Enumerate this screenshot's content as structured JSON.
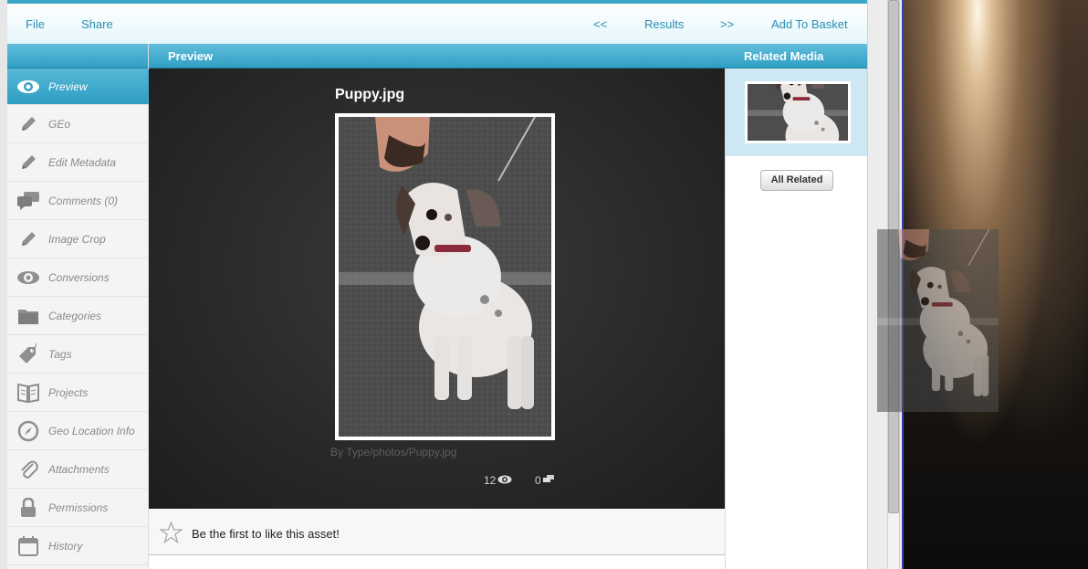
{
  "menu": {
    "file": "File",
    "share": "Share",
    "prev": "<<",
    "results": "Results",
    "next": ">>",
    "add_to_basket": "Add To Basket"
  },
  "headers": {
    "preview": "Preview",
    "related_media": "Related Media"
  },
  "sidebar": {
    "items": [
      {
        "label": "Preview",
        "icon": "eye-icon",
        "active": true
      },
      {
        "label": "GEo",
        "icon": "pencil-icon"
      },
      {
        "label": "Edit Metadata",
        "icon": "pencil-icon"
      },
      {
        "label": "Comments (0)",
        "icon": "comments-icon"
      },
      {
        "label": "Image Crop",
        "icon": "pencil-icon"
      },
      {
        "label": "Conversions",
        "icon": "eye-icon"
      },
      {
        "label": "Categories",
        "icon": "folder-icon"
      },
      {
        "label": "Tags",
        "icon": "tag-icon"
      },
      {
        "label": "Projects",
        "icon": "book-icon"
      },
      {
        "label": "Geo Location Info",
        "icon": "compass-icon"
      },
      {
        "label": "Attachments",
        "icon": "paperclip-icon"
      },
      {
        "label": "Permissions",
        "icon": "lock-icon"
      },
      {
        "label": "History",
        "icon": "calendar-icon"
      }
    ]
  },
  "asset": {
    "title": "Puppy.jpg",
    "path": "By Type/photos/Puppy.jpg",
    "views": "12",
    "comments": "0"
  },
  "like": {
    "text": "Be the first to like this asset!"
  },
  "related": {
    "button": "All Related"
  },
  "colors": {
    "accent": "#3aa7c7",
    "menu_text": "#2a8fb1",
    "preview_bg": "#2a2a2a"
  }
}
